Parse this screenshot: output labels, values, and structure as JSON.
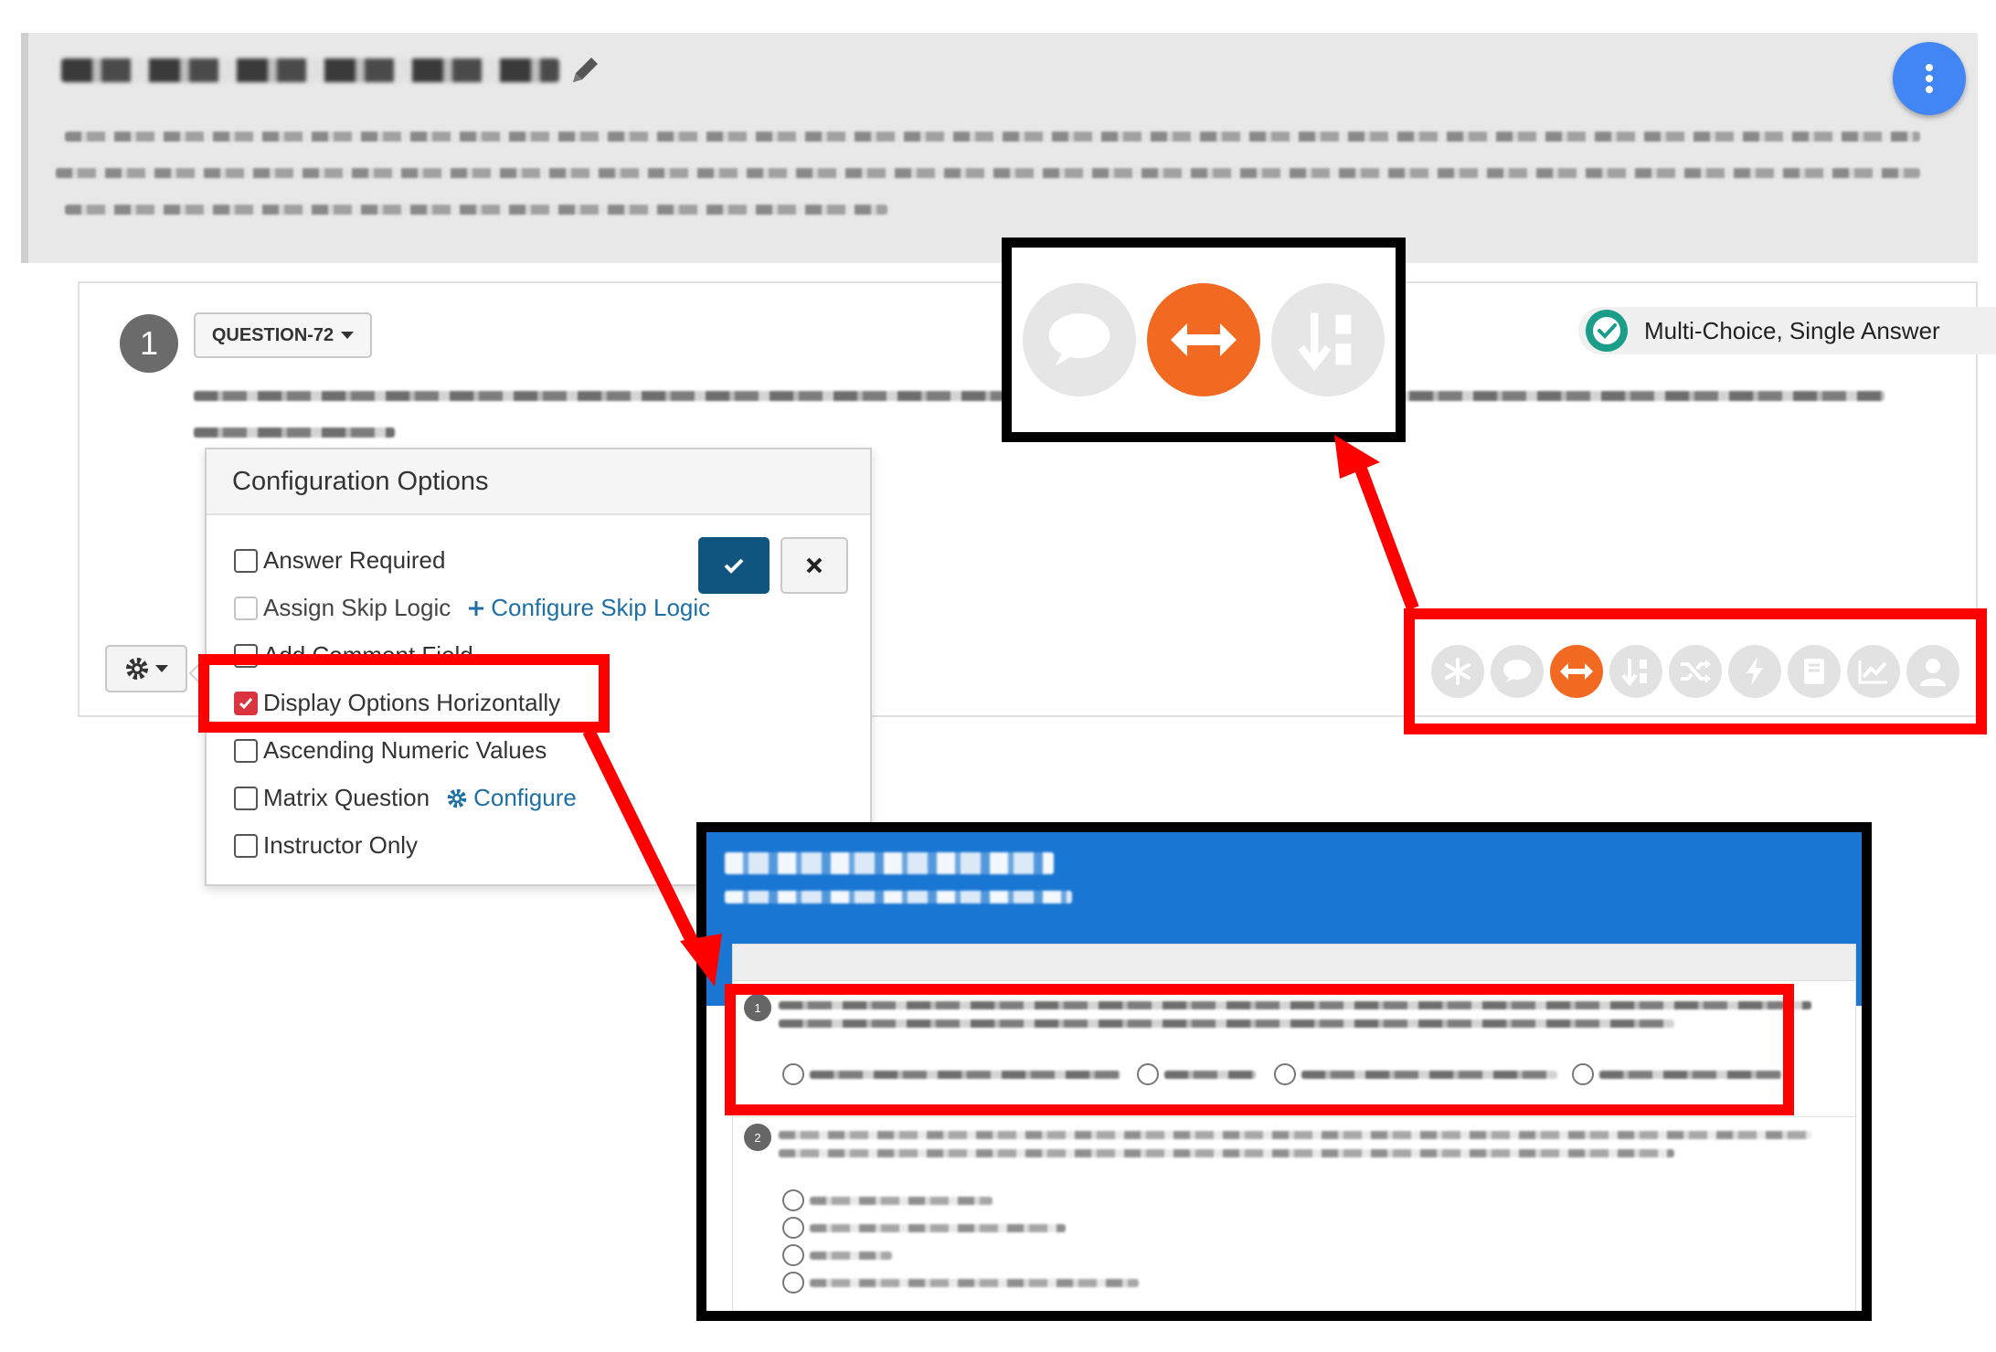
{
  "question": {
    "number": "1",
    "id_label": "QUESTION-72",
    "type_label": "Multi-Choice, Single Answer"
  },
  "config": {
    "title": "Configuration Options",
    "options": [
      {
        "label": "Answer Required",
        "checked": false,
        "enabled": true
      },
      {
        "label": "Assign Skip Logic",
        "checked": false,
        "enabled": false,
        "link": "Configure Skip Logic"
      },
      {
        "label": "Add Comment Field",
        "checked": false,
        "enabled": true
      },
      {
        "label": "Display Options Horizontally",
        "checked": true,
        "enabled": true
      },
      {
        "label": "Ascending Numeric Values",
        "checked": false,
        "enabled": true
      },
      {
        "label": "Matrix Question",
        "checked": false,
        "enabled": true,
        "link": "Configure"
      },
      {
        "label": "Instructor Only",
        "checked": false,
        "enabled": true
      }
    ]
  },
  "preview": {
    "question_numbers": [
      "1",
      "2"
    ]
  },
  "colors": {
    "accent_orange": "#f26a22",
    "highlight_red": "#ff0000",
    "primary_dark": "#105580",
    "link_blue": "#1d6fa5",
    "fab_blue": "#4285f4",
    "preview_blue": "#1976d2",
    "check_green": "#1a9e8a"
  },
  "icons": {
    "toolbar": [
      "asterisk-icon",
      "comment-icon",
      "arrows-horizontal-icon",
      "sort-numeric-icon",
      "shuffle-icon",
      "bolt-icon",
      "book-icon",
      "chart-line-icon",
      "user-icon"
    ],
    "zoomed": [
      "comment-icon",
      "arrows-horizontal-icon",
      "sort-numeric-icon"
    ]
  }
}
